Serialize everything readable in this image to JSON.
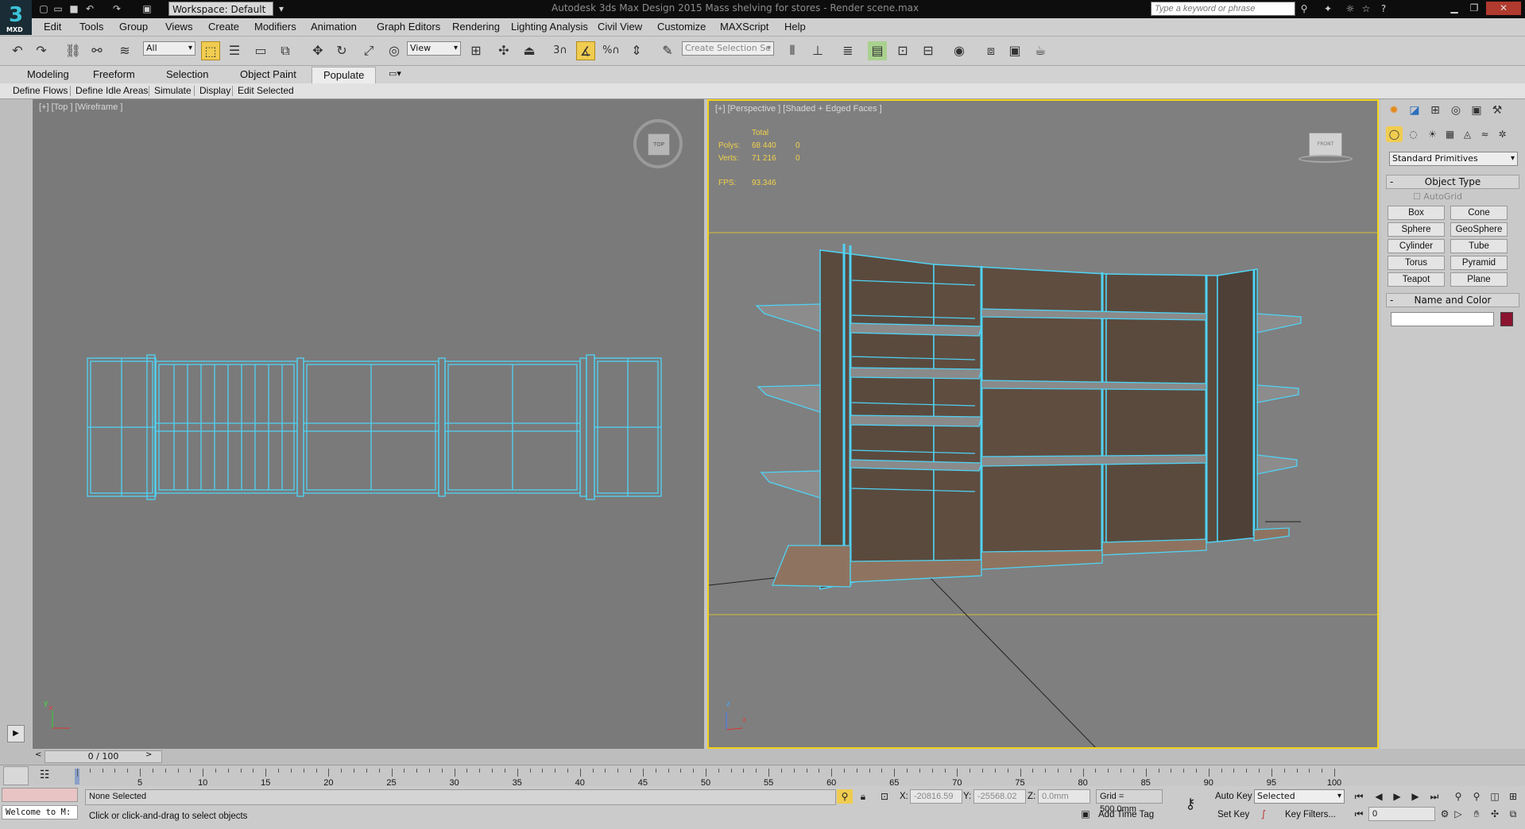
{
  "title_bar": {
    "app_title": "Autodesk 3ds Max Design 2015      Mass shelving for stores - Render scene.max",
    "workspace": "Workspace: Default",
    "search_placeholder": "Type a keyword or phrase",
    "logo_text": "MXD"
  },
  "menu": [
    "Edit",
    "Tools",
    "Group",
    "Views",
    "Create",
    "Modifiers",
    "Animation",
    "Graph Editors",
    "Rendering",
    "Lighting Analysis",
    "Civil View",
    "Customize",
    "MAXScript",
    "Help"
  ],
  "toolbar": {
    "selection_filter": "All",
    "reference_coord": "View",
    "named_selection_placeholder": "Create Selection Se",
    "snap_label": "3",
    "percent_label": "%"
  },
  "ribbon": {
    "tabs": [
      "Modeling",
      "Freeform",
      "Selection",
      "Object Paint",
      "Populate"
    ],
    "active_tab": "Populate",
    "sub_items": [
      "Define Flows",
      "Define Idle Areas",
      "Simulate",
      "Display",
      "Edit Selected"
    ]
  },
  "viewports": {
    "top_label": "[+] [Top ] [Wireframe ]",
    "top_cube": "TOP",
    "persp_label": "[+] [Perspective ] [Shaded + Edged Faces ]",
    "persp_cube": "FRONT",
    "stats": {
      "total_label": "Total",
      "polys_label": "Polys:",
      "polys_total": "68 440",
      "polys_sel": "0",
      "verts_label": "Verts:",
      "verts_total": "71 216",
      "verts_sel": "0",
      "fps_label": "FPS:",
      "fps_value": "93.346"
    },
    "axis_x": "x",
    "axis_y": "y",
    "axis_z": "z"
  },
  "command_panel": {
    "category": "Standard Primitives",
    "object_type_title": "Object Type",
    "autogrid": "AutoGrid",
    "buttons": [
      "Box",
      "Cone",
      "Sphere",
      "GeoSphere",
      "Cylinder",
      "Tube",
      "Torus",
      "Pyramid",
      "Teapot",
      "Plane"
    ],
    "name_color_title": "Name and Color",
    "object_color": "#8b1430"
  },
  "time_slider": {
    "frame": "0 / 100",
    "ticks": [
      "5",
      "10",
      "15",
      "20",
      "25",
      "30",
      "35",
      "40",
      "45",
      "50",
      "55",
      "60",
      "65",
      "70",
      "75",
      "80",
      "85",
      "90",
      "95",
      "100"
    ]
  },
  "status": {
    "maxscript": "Welcome to M:",
    "selection": "None Selected",
    "prompt": "Click or click-and-drag to select objects",
    "x_label": "X:",
    "x_value": "-20816.59",
    "y_label": "Y:",
    "y_value": "-25568.02",
    "z_label": "Z:",
    "z_value": "0.0mm",
    "grid": "Grid = 500.0mm",
    "add_time_tag": "Add Time Tag",
    "auto_key": "Auto Key",
    "set_key": "Set Key",
    "key_mode": "Selected",
    "key_filters": "Key Filters...",
    "current_frame": "0"
  },
  "colors": {
    "wire": "#4fd3f5",
    "active_viewport_border": "#f2d21b",
    "stat_text": "#f0d24b",
    "wood": "#5a4a3e"
  }
}
